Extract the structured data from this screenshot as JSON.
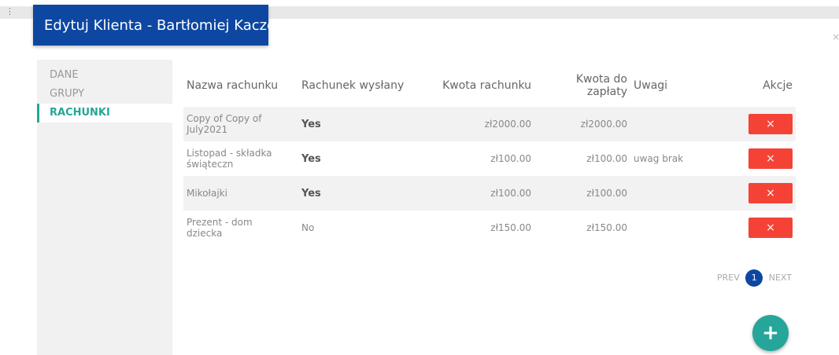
{
  "window": {
    "dots": "⋮",
    "close": "×"
  },
  "modal": {
    "title": "Edytuj Klienta - Bartłomiej Kaczor"
  },
  "sidebar": {
    "items": [
      {
        "label": "DANE"
      },
      {
        "label": "GRUPY"
      },
      {
        "label": "RACHUNKI"
      }
    ]
  },
  "table": {
    "headers": {
      "name": "Nazwa rachunku",
      "sent": "Rachunek wysłany",
      "amount": "Kwota rachunku",
      "due_line1": "Kwota do",
      "due_line2": "zapłaty",
      "notes": "Uwagi",
      "actions": "Akcje"
    },
    "rows": [
      {
        "name_line1": "Copy of Copy of",
        "name_line2": "July2021",
        "sent": "Yes",
        "amount": "zł2000.00",
        "due": "zł2000.00",
        "notes": "",
        "action": "×"
      },
      {
        "name_line1": "Listopad - składka",
        "name_line2": "świąteczn",
        "sent": "Yes",
        "amount": "zł100.00",
        "due": "zł100.00",
        "notes": "uwag brak",
        "action": "×"
      },
      {
        "name_line1": "Mikołajki",
        "name_line2": "",
        "sent": "Yes",
        "amount": "zł100.00",
        "due": "zł100.00",
        "notes": "",
        "action": "×"
      },
      {
        "name_line1": "Prezent - dom",
        "name_line2": "dziecka",
        "sent": "No",
        "amount": "zł150.00",
        "due": "zł150.00",
        "notes": "",
        "action": "×"
      }
    ]
  },
  "pagination": {
    "prev": "PREV",
    "page": "1",
    "next": "NEXT"
  },
  "fab": {
    "label": "+"
  },
  "colors": {
    "primary": "#0d47a1",
    "accent": "#26a69a",
    "danger": "#f44336"
  }
}
